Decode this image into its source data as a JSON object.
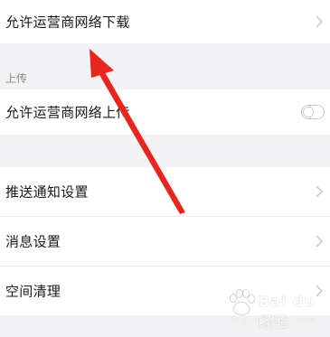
{
  "rows": {
    "download": {
      "label": "允许运营商网络下载"
    },
    "upload": {
      "label": "允许运营商网络上传"
    },
    "push": {
      "label": "推送通知设置"
    },
    "message": {
      "label": "消息设置"
    },
    "space": {
      "label": "空间清理"
    }
  },
  "sections": {
    "upload_title": "上传"
  },
  "toggles": {
    "carrier_upload_enabled": false
  },
  "icons": {
    "chevron": "chevron-right-icon",
    "toggle": "switch-icon",
    "annotation": "red-arrow-icon",
    "watermark": "baidu-paw-icon"
  },
  "colors": {
    "background": "#f3f3f5",
    "row": "#ffffff",
    "arrow": "#e8261e",
    "chevron": "#c6c6c6"
  },
  "watermark": {
    "brand": "Bai du 经验",
    "url": "jingyan.baidu.com"
  }
}
